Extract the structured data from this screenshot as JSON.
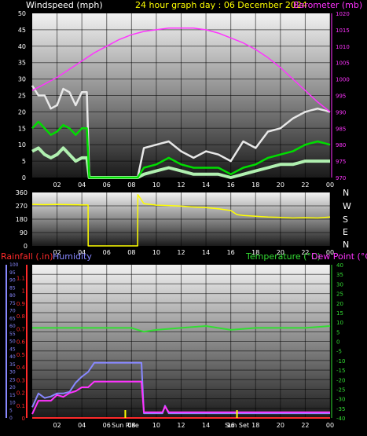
{
  "header": {
    "windspeed_label": "Windspeed (mph)",
    "title": "24 hour graph day : 06 December 2024",
    "barometer_label": "Barometer (mb)"
  },
  "colors": {
    "windspeed": "#ffffff",
    "title": "#ffff00",
    "barometer": "#ff33ff",
    "gust": "#e8e8e8",
    "avg": "#00dd00",
    "lull": "#b0f0b0",
    "direction": "#ffff00",
    "rain": "#ff2a2a",
    "humidity": "#8888ff",
    "temperature": "#33dd33",
    "dewpoint": "#ff33ff",
    "sun": "#ffff00"
  },
  "x_ticks": [
    "02",
    "04",
    "06",
    "08",
    "10",
    "12",
    "14",
    "16",
    "18",
    "20",
    "22",
    "00"
  ],
  "dir_letters": [
    "N",
    "W",
    "S",
    "E",
    "N"
  ],
  "legend3": {
    "rainfall": "Rainfall (.in)",
    "humidity": "Humidity",
    "temperature": "Temperature (°C)",
    "dewpoint": "Dew Point (°C)",
    "sunrise": "Sun Rise",
    "sunset": "Sun Set"
  },
  "chart_data": [
    {
      "type": "line",
      "title": "24 hour graph day : 06 December 2024",
      "xlim": [
        0,
        24
      ],
      "y_left": {
        "label": "Windspeed (mph)",
        "ylim": [
          0,
          50
        ],
        "ticks": [
          0,
          5,
          10,
          15,
          20,
          25,
          30,
          35,
          40,
          45,
          50
        ]
      },
      "y_right": {
        "label": "Barometer (mb)",
        "ylim": [
          970,
          1020
        ],
        "ticks": [
          970,
          975,
          980,
          985,
          990,
          995,
          1000,
          1005,
          1010,
          1015,
          1020
        ]
      },
      "series": [
        {
          "name": "gust",
          "axis": "left",
          "x": [
            0,
            0.5,
            1,
            1.5,
            2,
            2.5,
            3,
            3.5,
            4,
            4.4,
            4.6,
            8.5,
            9,
            10,
            11,
            12,
            13,
            14,
            15,
            16,
            17,
            18,
            19,
            20,
            21,
            22,
            23,
            24
          ],
          "values": [
            28,
            25,
            25,
            21,
            22,
            27,
            26,
            22,
            26,
            26,
            0,
            0,
            9,
            10,
            11,
            8,
            6,
            8,
            7,
            5,
            11,
            9,
            14,
            15,
            18,
            20,
            21,
            20
          ]
        },
        {
          "name": "average",
          "axis": "left",
          "x": [
            0,
            0.5,
            1,
            1.5,
            2,
            2.5,
            3,
            3.5,
            4,
            4.4,
            4.6,
            8.5,
            9,
            10,
            11,
            12,
            13,
            14,
            15,
            16,
            17,
            18,
            19,
            20,
            21,
            22,
            23,
            24
          ],
          "values": [
            15,
            17,
            15,
            13,
            14,
            16,
            15,
            13,
            15,
            15,
            0,
            0,
            3,
            4,
            6,
            4,
            3,
            3,
            3,
            1,
            3,
            4,
            6,
            7,
            8,
            10,
            11,
            10
          ]
        },
        {
          "name": "lull",
          "axis": "left",
          "x": [
            0,
            0.5,
            1,
            1.5,
            2,
            2.5,
            3,
            3.5,
            4,
            4.4,
            4.6,
            8.5,
            9,
            10,
            11,
            12,
            13,
            14,
            15,
            16,
            17,
            18,
            19,
            20,
            21,
            22,
            23,
            24
          ],
          "values": [
            8,
            9,
            7,
            6,
            7,
            9,
            7,
            5,
            6,
            6,
            0,
            0,
            1,
            2,
            3,
            2,
            1,
            1,
            1,
            0,
            1,
            2,
            3,
            4,
            4,
            5,
            5,
            5
          ]
        },
        {
          "name": "barometer",
          "axis": "right",
          "x": [
            0,
            1,
            2,
            3,
            4,
            5,
            6,
            7,
            8,
            9,
            10,
            11,
            12,
            13,
            14,
            15,
            16,
            17,
            18,
            19,
            20,
            21,
            22,
            23,
            24
          ],
          "values": [
            996.5,
            998.5,
            1000.5,
            1003,
            1005.5,
            1008,
            1010,
            1012,
            1013.5,
            1014.5,
            1015,
            1015.5,
            1015.5,
            1015.5,
            1015,
            1014,
            1012.5,
            1011,
            1009,
            1006.5,
            1003.5,
            1000,
            996.5,
            993,
            990
          ]
        }
      ]
    },
    {
      "type": "line",
      "title": "",
      "xlim": [
        0,
        24
      ],
      "ylim": [
        0,
        360
      ],
      "y_ticks": [
        0,
        90,
        180,
        270,
        360
      ],
      "series": [
        {
          "name": "wind direction",
          "x": [
            0,
            1,
            2,
            3,
            4,
            4.5,
            4.51,
            8.5,
            8.51,
            9,
            10,
            11,
            12,
            13,
            14,
            15,
            16,
            16.5,
            17,
            18,
            19,
            20,
            21,
            22,
            23,
            24
          ],
          "values": [
            280,
            278,
            280,
            278,
            276,
            276,
            0,
            0,
            345,
            285,
            275,
            272,
            268,
            262,
            258,
            250,
            238,
            210,
            205,
            200,
            195,
            192,
            188,
            190,
            188,
            195
          ]
        }
      ]
    },
    {
      "type": "line",
      "title": "",
      "xlim": [
        0,
        24
      ],
      "y_left_rain": {
        "label": "Rainfall (.in)",
        "ylim": [
          0,
          1.2
        ],
        "ticks": [
          0,
          0.1,
          0.2,
          0.3,
          0.4,
          0.5,
          0.6,
          0.7,
          0.8,
          0.9,
          1,
          1.1
        ]
      },
      "y_left_humidity": {
        "label": "Humidity",
        "ylim": [
          0,
          100
        ],
        "ticks": [
          0,
          5,
          10,
          15,
          20,
          25,
          30,
          35,
          40,
          45,
          50,
          55,
          60,
          65,
          70,
          75,
          80,
          85,
          90,
          95,
          100
        ]
      },
      "y_right": {
        "label": "Temperature (°C) / Dew Point (°C)",
        "ylim": [
          -40,
          40
        ],
        "ticks": [
          40,
          35,
          30,
          25,
          20,
          15,
          10,
          5,
          0,
          -5,
          -10,
          -15,
          -20,
          -25,
          -30,
          -35,
          -40
        ]
      },
      "annotations": [
        {
          "x": 7.5,
          "text": "Sun Rise"
        },
        {
          "x": 16.5,
          "text": "Sun Set"
        }
      ],
      "series": [
        {
          "name": "Temperature",
          "axis": "right",
          "x": [
            0,
            2,
            4,
            6,
            8,
            9,
            10,
            12,
            14,
            16,
            18,
            20,
            22,
            24
          ],
          "values": [
            7,
            7,
            7,
            7,
            7,
            5,
            6,
            7,
            8,
            6,
            7,
            7,
            7,
            8
          ]
        },
        {
          "name": "Dew Point",
          "axis": "right",
          "x": [
            0,
            0.5,
            1,
            1.5,
            2,
            2.5,
            3,
            3.5,
            4,
            4.5,
            5,
            6,
            7,
            8,
            8.8,
            9,
            10,
            10.5,
            10.7,
            11,
            12,
            13,
            14,
            15,
            16,
            17,
            18,
            19,
            20,
            21,
            22,
            23,
            24
          ],
          "values": [
            -38,
            -31,
            -31,
            -31,
            -28,
            -29,
            -27,
            -26,
            -24,
            -24,
            -21,
            -21,
            -21,
            -21,
            -21,
            -37,
            -37,
            -37,
            -34,
            -37,
            -37,
            -37,
            -37,
            -37,
            -37,
            -37,
            -37,
            -37,
            -37,
            -37,
            -37,
            -37,
            -37
          ]
        },
        {
          "name": "Humidity",
          "axis": "left_humidity",
          "x": [
            0,
            0.5,
            1,
            1.5,
            2,
            2.5,
            3,
            3.5,
            4,
            4.5,
            5,
            6,
            7,
            8,
            8.8,
            9,
            10,
            10.5,
            10.7,
            11,
            12,
            14,
            16,
            18,
            20,
            22,
            24
          ],
          "values": [
            7,
            16,
            13,
            14,
            16,
            16,
            17,
            23,
            27,
            30,
            36,
            36,
            36,
            36,
            36,
            3,
            3,
            3,
            8,
            3,
            3,
            3,
            3,
            3,
            3,
            3,
            3
          ]
        },
        {
          "name": "Rainfall",
          "axis": "left_rain",
          "x": [
            0,
            24
          ],
          "values": [
            0,
            0
          ]
        }
      ]
    }
  ]
}
